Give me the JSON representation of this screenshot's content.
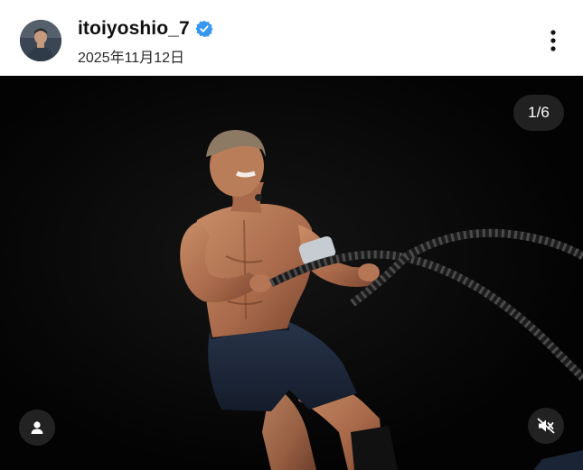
{
  "post": {
    "username": "itoiyoshio_7",
    "verified": true,
    "date": "2025年11月12日",
    "avatar_icon": "profile-photo",
    "more_icon": "more-vertical-icon"
  },
  "media": {
    "counter": "1/6",
    "tag_icon": "user-tag-icon",
    "mute_icon": "volume-muted-icon",
    "photo_subject": "athlete-with-battle-ropes"
  },
  "colors": {
    "verified_blue": "#3897f0",
    "media_background": "#050505",
    "overlay_badge": "#282828"
  }
}
